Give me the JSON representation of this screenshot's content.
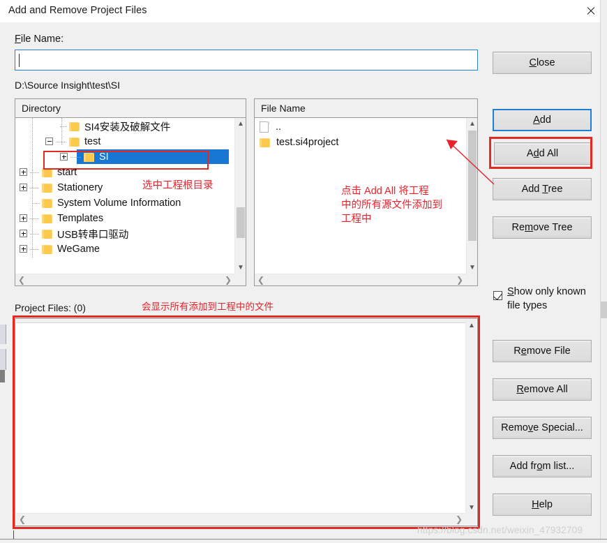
{
  "window": {
    "title": "Add and Remove Project Files",
    "close_icon": "close-icon"
  },
  "form": {
    "file_name_label": "File Name:",
    "file_name_value": "",
    "file_name_accel": "F",
    "current_path": "D:\\Source Insight\\test\\SI"
  },
  "directory_panel": {
    "header": "Directory",
    "items": [
      {
        "label": "SI4安装及破解文件",
        "indent": 2,
        "expander": "none",
        "selected": false
      },
      {
        "label": "test",
        "indent": 1,
        "expander": "minus",
        "selected": false
      },
      {
        "label": "SI",
        "indent": 2,
        "expander": "plus",
        "selected": true
      },
      {
        "label": "start",
        "indent": 0,
        "expander": "plus",
        "selected": false
      },
      {
        "label": "Stationery",
        "indent": 0,
        "expander": "plus",
        "selected": false
      },
      {
        "label": "System Volume Information",
        "indent": 0,
        "expander": "none",
        "selected": false
      },
      {
        "label": "Templates",
        "indent": 0,
        "expander": "plus",
        "selected": false
      },
      {
        "label": "USB转串口驱动",
        "indent": 0,
        "expander": "plus",
        "selected": false
      },
      {
        "label": "WeGame",
        "indent": 0,
        "expander": "plus",
        "selected": false
      }
    ]
  },
  "file_panel": {
    "header": "File Name",
    "items": [
      {
        "label": "..",
        "icon": "document-icon"
      },
      {
        "label": "test.si4project",
        "icon": "folder-icon"
      }
    ]
  },
  "buttons": {
    "close": {
      "label": "Close",
      "accel": "C"
    },
    "add": {
      "label": "Add",
      "accel": "A",
      "focused": true
    },
    "add_all": {
      "label": "Add All",
      "accel": "d",
      "highlighted": true
    },
    "add_tree": {
      "label": "Add Tree",
      "accel": "T"
    },
    "remove_tree": {
      "label": "Remove Tree",
      "accel": "m"
    },
    "remove_file": {
      "label": "Remove File",
      "accel": "e"
    },
    "remove_all": {
      "label": "Remove All",
      "accel": "R"
    },
    "remove_special": {
      "label": "Remove Special...",
      "accel": "v"
    },
    "add_from_list": {
      "label": "Add from list...",
      "accel": "o"
    },
    "help": {
      "label": "Help",
      "accel": "H"
    }
  },
  "checkbox": {
    "label_line1": "Show only known",
    "label_line2": "file types",
    "checked": true
  },
  "project_files": {
    "label": "Project Files: (0)",
    "count": 0,
    "items": []
  },
  "annotations": [
    {
      "id": "select-root-dir",
      "text": "选中工程根目录"
    },
    {
      "id": "click-add-all-l1",
      "text": "点击 Add All 将工程"
    },
    {
      "id": "click-add-all-l2",
      "text": "中的所有源文件添加到"
    },
    {
      "id": "click-add-all-l3",
      "text": "工程中"
    },
    {
      "id": "project-files-note",
      "text": "会显示所有添加到工程中的文件"
    }
  ],
  "watermark": {
    "text": "https://blog.csdn.net/weixin_47932709"
  },
  "colors": {
    "accent_blue": "#1877d2",
    "annotation_red": "#e8212a",
    "highlight_red": "#e02a23",
    "dialog_bg": "#f0f0f0",
    "folder_yellow": "#fbc94b"
  }
}
